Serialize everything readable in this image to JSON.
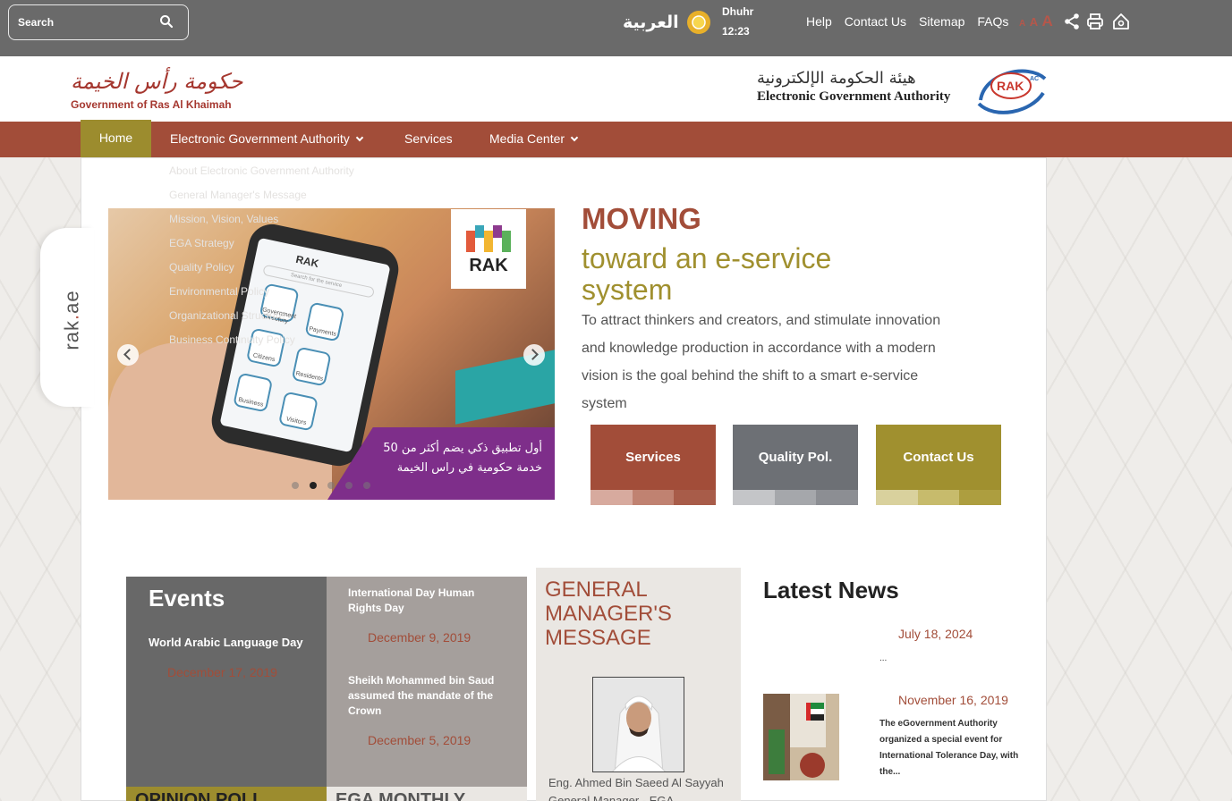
{
  "colors": {
    "top_bar": "#6a6a6a",
    "nav_bar": "#a24d39",
    "nav_active": "#9c8c2e",
    "accent_red": "#a24d39",
    "accent_gold": "#a0902f",
    "accent_gray": "#6d7075"
  },
  "topbar": {
    "search_placeholder": "Search",
    "arabic_label": "العربية",
    "prayer_name": "Dhuhr",
    "prayer_time": "12:23",
    "links": [
      "Help",
      "Contact Us",
      "Sitemap",
      "FAQs"
    ],
    "font_size_labels": [
      "A",
      "A",
      "A"
    ],
    "icons": [
      "search-icon",
      "sun-icon",
      "share-icon",
      "print-icon",
      "home-icon"
    ]
  },
  "header": {
    "rak_arabic": "حكومة رأس الخيمة",
    "rak_english": "Government of Ras Al Khaimah",
    "ega_arabic": "هيئة الحكومة الإلكترونية",
    "ega_english": "Electronic Government Authority",
    "ega_logo_text": "RAK",
    "ega_logo_sup": "AC"
  },
  "nav": {
    "items": [
      {
        "label": "Home",
        "active": true
      },
      {
        "label": "Electronic Government Authority",
        "has_dropdown": true
      },
      {
        "label": "Services"
      },
      {
        "label": "Media Center",
        "has_dropdown": true
      }
    ],
    "dropdown": [
      "About Electronic Government Authority",
      "General Manager's Message",
      "Mission, Vision, Values",
      "EGA Strategy",
      "Quality Policy",
      "Environmental Policy",
      "Organizational Structure",
      "Business Continuity Policy"
    ]
  },
  "side_tab": {
    "text_main": "rak",
    "text_dot": ".",
    "text_end": "ae"
  },
  "slider": {
    "badge_text": "RAK",
    "app_logo": "RAK",
    "app_search": "Search for the service",
    "app_tiles": [
      "Government Directory",
      "Payments",
      "Citizens",
      "Residents",
      "Business",
      "Visitors"
    ],
    "arabic_caption_line1": "أول تطبيق ذكي يضم أكثر من 50",
    "arabic_caption_line2": "خدمة حكومية   في راس الخيمة",
    "slide_count": 5,
    "active_slide": 2
  },
  "hero": {
    "heading": "MOVING",
    "subheading": "toward an e-service system",
    "paragraph": "To attract thinkers and creators, and stimulate innovation and knowledge production in accordance with a modern vision is the goal behind the shift to a smart e-service system"
  },
  "quick_buttons": [
    {
      "label": "Services",
      "color": "#a24d39",
      "strip": [
        "#d7aa9e",
        "#c08271",
        "#a85c49"
      ]
    },
    {
      "label": "Quality Pol.",
      "color": "#6d7075",
      "strip": [
        "#c4c5c8",
        "#a5a7ab",
        "#8c8e93"
      ]
    },
    {
      "label": "Contact Us",
      "color": "#a0902f",
      "strip": [
        "#d9d19d",
        "#c7bb6c",
        "#ad9e3f"
      ]
    }
  ],
  "events": {
    "title": "Events",
    "item1_title": "World Arabic Language Day",
    "item1_date": "December 17, 2019",
    "item2_title": "International Day Human Rights Day",
    "item2_date": "December 9, 2019",
    "item3_title": "Sheikh Mohammed bin Saud assumed the mandate of the Crown",
    "item3_date": "December 5, 2019"
  },
  "gm_message": {
    "title_line1": "GENERAL",
    "title_line2": "MANAGER'S",
    "title_line3": "MESSAGE",
    "name": "Eng. Ahmed Bin Saeed Al Sayyah",
    "role": "General Manager - EGA"
  },
  "bottom_tiles": {
    "poll": "OPINION POLL",
    "monthly": "EGA MONTHLY"
  },
  "news": {
    "title": "Latest News",
    "item1_date": "July 18, 2024",
    "item1_text": "...",
    "item2_date": "November 16, 2019",
    "item2_text": "The eGovernment Authority organized a special event for International Tolerance Day, with the..."
  }
}
